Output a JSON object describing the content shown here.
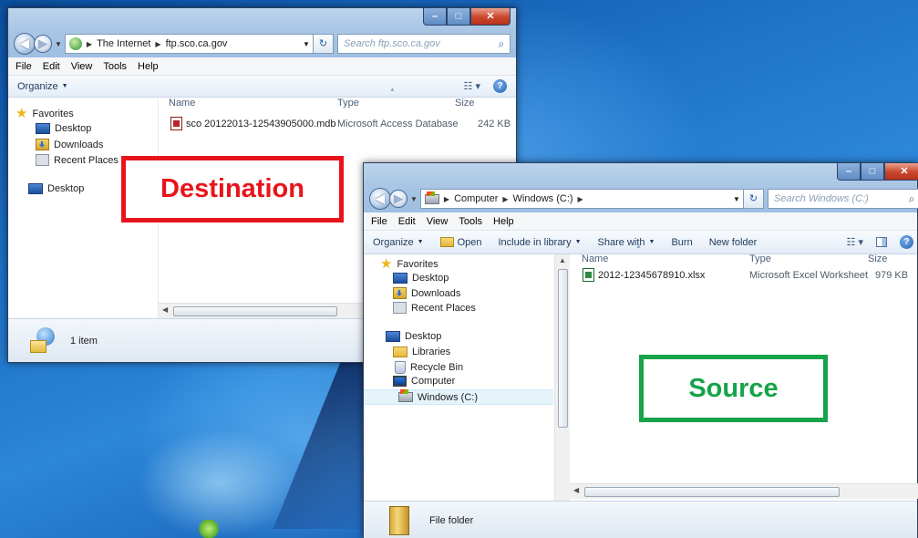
{
  "destination_window": {
    "address": {
      "crumbs": [
        "The Internet",
        "ftp.sco.ca.gov"
      ]
    },
    "search_placeholder": "Search ftp.sco.ca.gov",
    "menu": [
      "File",
      "Edit",
      "View",
      "Tools",
      "Help"
    ],
    "organize_label": "Organize",
    "nav": {
      "favorites": "Favorites",
      "desktop": "Desktop",
      "downloads": "Downloads",
      "recent_places": "Recent Places",
      "desktop_root": "Desktop"
    },
    "columns": {
      "name": "Name",
      "type": "Type",
      "size": "Size"
    },
    "files": [
      {
        "name": "sco 20122013-12543905000.mdb",
        "type": "Microsoft Access Database",
        "size": "242 KB",
        "icon": "access-file-icon"
      }
    ],
    "status": "1 item",
    "callout": {
      "text": "Destination",
      "color": "#e8141b"
    }
  },
  "source_window": {
    "address": {
      "crumbs": [
        "Computer",
        "Windows (C:)"
      ]
    },
    "search_placeholder": "Search Windows (C:)",
    "menu": [
      "File",
      "Edit",
      "View",
      "Tools",
      "Help"
    ],
    "toolbar": {
      "organize": "Organize",
      "open": "Open",
      "include_in_library": "Include in library",
      "share_with": "Share with",
      "burn": "Burn",
      "new_folder": "New folder"
    },
    "nav": {
      "favorites": "Favorites",
      "desktop": "Desktop",
      "downloads": "Downloads",
      "recent_places": "Recent Places",
      "desktop_root": "Desktop",
      "libraries": "Libraries",
      "recycle_bin": "Recycle Bin",
      "computer": "Computer",
      "windows_c": "Windows (C:)"
    },
    "columns": {
      "name": "Name",
      "type": "Type",
      "size": "Size"
    },
    "files": [
      {
        "name": "2012-12345678910.xlsx",
        "type": "Microsoft Excel Worksheet",
        "size": "979 KB",
        "icon": "excel-file-icon"
      }
    ],
    "status": "File folder",
    "callout": {
      "text": "Source",
      "color": "#16a34a"
    }
  }
}
